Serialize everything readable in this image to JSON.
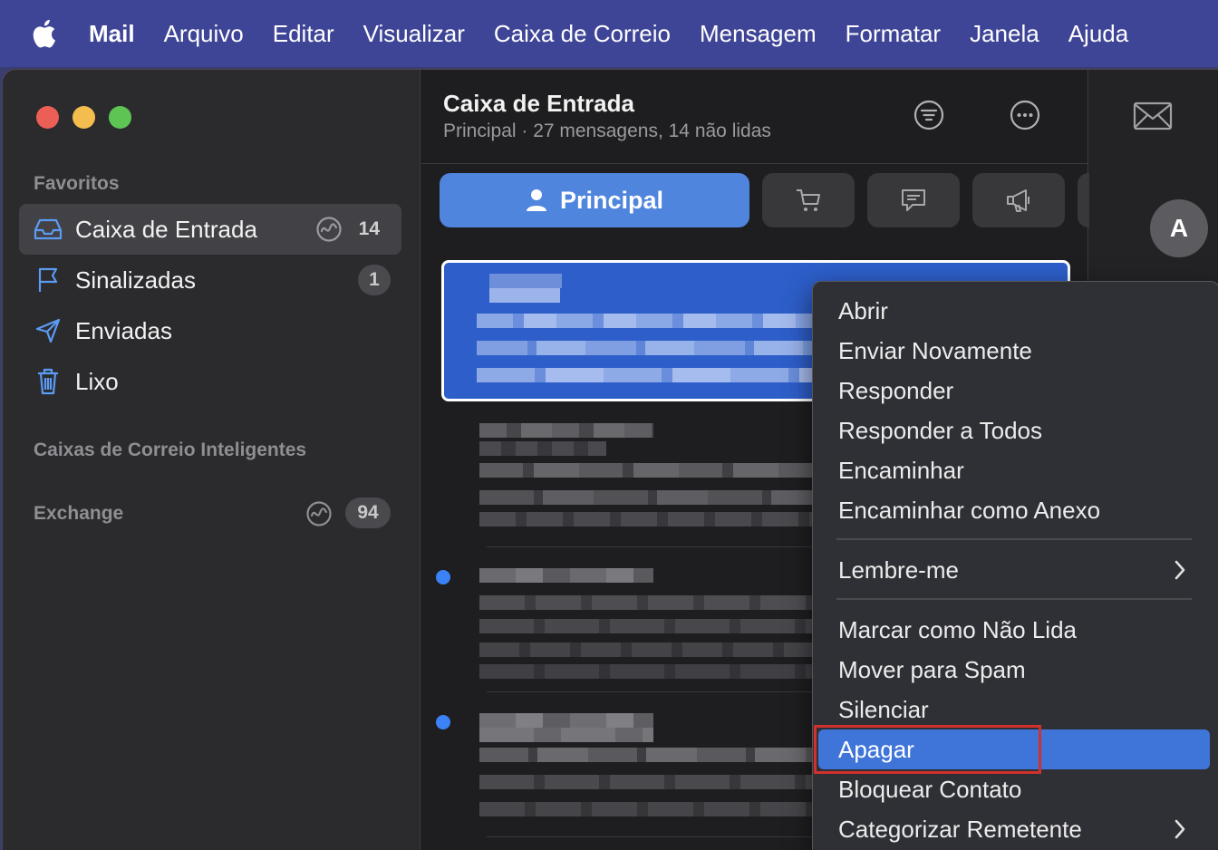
{
  "menubar": {
    "apple_icon": "apple-logo-icon",
    "items": [
      "Mail",
      "Arquivo",
      "Editar",
      "Visualizar",
      "Caixa de Correio",
      "Mensagem",
      "Formatar",
      "Janela",
      "Ajuda"
    ]
  },
  "sidebar": {
    "favorites_heading": "Favoritos",
    "items": [
      {
        "label": "Caixa de Entrada",
        "count": "14",
        "icon": "inbox-icon"
      },
      {
        "label": "Sinalizadas",
        "count": "1",
        "icon": "flag-icon"
      },
      {
        "label": "Enviadas",
        "icon": "paperplane-icon"
      },
      {
        "label": "Lixo",
        "icon": "trash-icon"
      }
    ],
    "smart_heading": "Caixas de Correio Inteligentes",
    "exchange": {
      "label": "Exchange",
      "count": "94"
    }
  },
  "list": {
    "title": "Caixa de Entrada",
    "subtitle": "Principal · 27 mensagens, 14 não lidas",
    "categories": {
      "primary_label": "Principal"
    }
  },
  "right": {
    "avatar_letter": "A"
  },
  "context_menu": {
    "items": [
      "Abrir",
      "Enviar Novamente",
      "Responder",
      "Responder a Todos",
      "Encaminhar",
      "Encaminhar como Anexo",
      "Lembre-me",
      "Marcar como Não Lida",
      "Mover para Spam",
      "Silenciar",
      "Apagar",
      "Bloquear Contato",
      "Categorizar Remetente"
    ],
    "highlighted": "Apagar"
  },
  "colors": {
    "accent": "#4f85dd",
    "selection": "#2d5ec9",
    "highlight_box": "#d0312d",
    "menubar": "#3f4596"
  }
}
